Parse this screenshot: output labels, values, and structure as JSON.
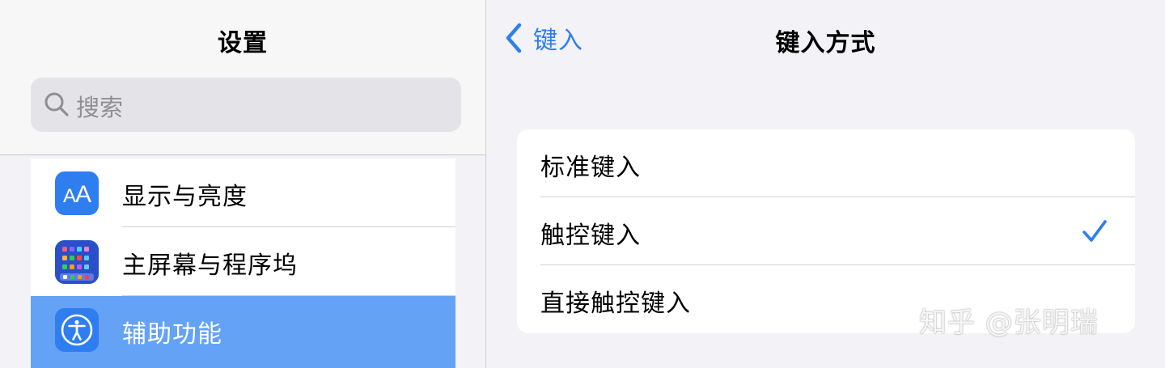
{
  "sidebar": {
    "title": "设置",
    "search": {
      "placeholder": "搜索",
      "icon": "search-icon"
    },
    "items": [
      {
        "label": "显示与亮度",
        "icon": "display-brightness-icon",
        "selected": false
      },
      {
        "label": "主屏幕与程序坞",
        "icon": "home-screen-dock-icon",
        "selected": false
      },
      {
        "label": "辅助功能",
        "icon": "accessibility-icon",
        "selected": true
      }
    ]
  },
  "detail": {
    "back_label": "键入",
    "title": "键入方式",
    "options": [
      {
        "label": "标准键入",
        "checked": false
      },
      {
        "label": "触控键入",
        "checked": true
      },
      {
        "label": "直接触控键入",
        "checked": false
      }
    ]
  },
  "watermark": "知乎 @张明瑞",
  "colors": {
    "accent": "#2f7ef0",
    "selection": "#64a2f6",
    "background": "#f2f2f7",
    "card": "#ffffff"
  }
}
